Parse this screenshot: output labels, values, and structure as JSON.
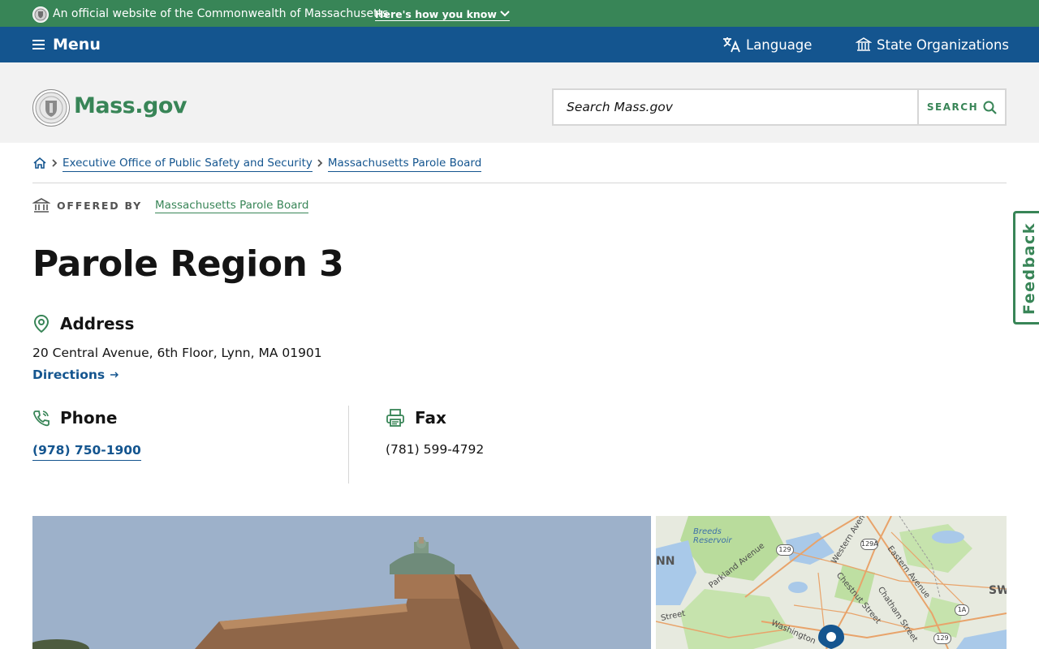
{
  "official_banner": {
    "text": "An official website of the Commonwealth of Massachusetts",
    "how_link": "Here's how you know"
  },
  "navbar": {
    "menu_label": "Menu",
    "language_label": "Language",
    "orgs_label": "State Organizations"
  },
  "header": {
    "logo_text": "Mass.gov",
    "search_placeholder": "Search Mass.gov",
    "search_button": "SEARCH"
  },
  "breadcrumb": {
    "items": [
      "Executive Office of Public Safety and Security",
      "Massachusetts Parole Board"
    ]
  },
  "offered_by": {
    "label": "OFFERED BY",
    "org": "Massachusetts Parole Board"
  },
  "page": {
    "title": "Parole Region 3"
  },
  "address": {
    "heading": "Address",
    "text": "20 Central Avenue, 6th Floor, Lynn, MA 01901",
    "directions": "Directions"
  },
  "phone": {
    "heading": "Phone",
    "number": "(978) 750-1900"
  },
  "fax": {
    "heading": "Fax",
    "number": "(781) 599-4792"
  },
  "feedback": {
    "label": "Feedback"
  },
  "map": {
    "labels": [
      "Breeds Reservoir",
      "Parkland Avenue",
      "Western Avenue",
      "Eastern Avenue",
      "Chestnut Street",
      "Chatham Street",
      "Washington",
      "Street",
      "NN",
      "SW"
    ],
    "shields": [
      "129",
      "129A",
      "1A",
      "129"
    ]
  },
  "colors": {
    "green": "#388557",
    "blue": "#14558f",
    "header_bg": "#f2f2f2"
  }
}
